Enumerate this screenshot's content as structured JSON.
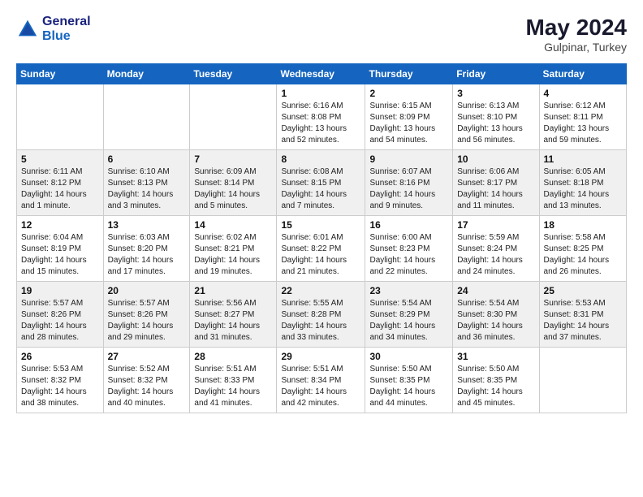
{
  "header": {
    "logo_line1": "General",
    "logo_line2": "Blue",
    "month_year": "May 2024",
    "location": "Gulpinar, Turkey"
  },
  "weekdays": [
    "Sunday",
    "Monday",
    "Tuesday",
    "Wednesday",
    "Thursday",
    "Friday",
    "Saturday"
  ],
  "weeks": [
    [
      {
        "day": "",
        "sunrise": "",
        "sunset": "",
        "daylight": ""
      },
      {
        "day": "",
        "sunrise": "",
        "sunset": "",
        "daylight": ""
      },
      {
        "day": "",
        "sunrise": "",
        "sunset": "",
        "daylight": ""
      },
      {
        "day": "1",
        "sunrise": "Sunrise: 6:16 AM",
        "sunset": "Sunset: 8:08 PM",
        "daylight": "Daylight: 13 hours and 52 minutes."
      },
      {
        "day": "2",
        "sunrise": "Sunrise: 6:15 AM",
        "sunset": "Sunset: 8:09 PM",
        "daylight": "Daylight: 13 hours and 54 minutes."
      },
      {
        "day": "3",
        "sunrise": "Sunrise: 6:13 AM",
        "sunset": "Sunset: 8:10 PM",
        "daylight": "Daylight: 13 hours and 56 minutes."
      },
      {
        "day": "4",
        "sunrise": "Sunrise: 6:12 AM",
        "sunset": "Sunset: 8:11 PM",
        "daylight": "Daylight: 13 hours and 59 minutes."
      }
    ],
    [
      {
        "day": "5",
        "sunrise": "Sunrise: 6:11 AM",
        "sunset": "Sunset: 8:12 PM",
        "daylight": "Daylight: 14 hours and 1 minute."
      },
      {
        "day": "6",
        "sunrise": "Sunrise: 6:10 AM",
        "sunset": "Sunset: 8:13 PM",
        "daylight": "Daylight: 14 hours and 3 minutes."
      },
      {
        "day": "7",
        "sunrise": "Sunrise: 6:09 AM",
        "sunset": "Sunset: 8:14 PM",
        "daylight": "Daylight: 14 hours and 5 minutes."
      },
      {
        "day": "8",
        "sunrise": "Sunrise: 6:08 AM",
        "sunset": "Sunset: 8:15 PM",
        "daylight": "Daylight: 14 hours and 7 minutes."
      },
      {
        "day": "9",
        "sunrise": "Sunrise: 6:07 AM",
        "sunset": "Sunset: 8:16 PM",
        "daylight": "Daylight: 14 hours and 9 minutes."
      },
      {
        "day": "10",
        "sunrise": "Sunrise: 6:06 AM",
        "sunset": "Sunset: 8:17 PM",
        "daylight": "Daylight: 14 hours and 11 minutes."
      },
      {
        "day": "11",
        "sunrise": "Sunrise: 6:05 AM",
        "sunset": "Sunset: 8:18 PM",
        "daylight": "Daylight: 14 hours and 13 minutes."
      }
    ],
    [
      {
        "day": "12",
        "sunrise": "Sunrise: 6:04 AM",
        "sunset": "Sunset: 8:19 PM",
        "daylight": "Daylight: 14 hours and 15 minutes."
      },
      {
        "day": "13",
        "sunrise": "Sunrise: 6:03 AM",
        "sunset": "Sunset: 8:20 PM",
        "daylight": "Daylight: 14 hours and 17 minutes."
      },
      {
        "day": "14",
        "sunrise": "Sunrise: 6:02 AM",
        "sunset": "Sunset: 8:21 PM",
        "daylight": "Daylight: 14 hours and 19 minutes."
      },
      {
        "day": "15",
        "sunrise": "Sunrise: 6:01 AM",
        "sunset": "Sunset: 8:22 PM",
        "daylight": "Daylight: 14 hours and 21 minutes."
      },
      {
        "day": "16",
        "sunrise": "Sunrise: 6:00 AM",
        "sunset": "Sunset: 8:23 PM",
        "daylight": "Daylight: 14 hours and 22 minutes."
      },
      {
        "day": "17",
        "sunrise": "Sunrise: 5:59 AM",
        "sunset": "Sunset: 8:24 PM",
        "daylight": "Daylight: 14 hours and 24 minutes."
      },
      {
        "day": "18",
        "sunrise": "Sunrise: 5:58 AM",
        "sunset": "Sunset: 8:25 PM",
        "daylight": "Daylight: 14 hours and 26 minutes."
      }
    ],
    [
      {
        "day": "19",
        "sunrise": "Sunrise: 5:57 AM",
        "sunset": "Sunset: 8:26 PM",
        "daylight": "Daylight: 14 hours and 28 minutes."
      },
      {
        "day": "20",
        "sunrise": "Sunrise: 5:57 AM",
        "sunset": "Sunset: 8:26 PM",
        "daylight": "Daylight: 14 hours and 29 minutes."
      },
      {
        "day": "21",
        "sunrise": "Sunrise: 5:56 AM",
        "sunset": "Sunset: 8:27 PM",
        "daylight": "Daylight: 14 hours and 31 minutes."
      },
      {
        "day": "22",
        "sunrise": "Sunrise: 5:55 AM",
        "sunset": "Sunset: 8:28 PM",
        "daylight": "Daylight: 14 hours and 33 minutes."
      },
      {
        "day": "23",
        "sunrise": "Sunrise: 5:54 AM",
        "sunset": "Sunset: 8:29 PM",
        "daylight": "Daylight: 14 hours and 34 minutes."
      },
      {
        "day": "24",
        "sunrise": "Sunrise: 5:54 AM",
        "sunset": "Sunset: 8:30 PM",
        "daylight": "Daylight: 14 hours and 36 minutes."
      },
      {
        "day": "25",
        "sunrise": "Sunrise: 5:53 AM",
        "sunset": "Sunset: 8:31 PM",
        "daylight": "Daylight: 14 hours and 37 minutes."
      }
    ],
    [
      {
        "day": "26",
        "sunrise": "Sunrise: 5:53 AM",
        "sunset": "Sunset: 8:32 PM",
        "daylight": "Daylight: 14 hours and 38 minutes."
      },
      {
        "day": "27",
        "sunrise": "Sunrise: 5:52 AM",
        "sunset": "Sunset: 8:32 PM",
        "daylight": "Daylight: 14 hours and 40 minutes."
      },
      {
        "day": "28",
        "sunrise": "Sunrise: 5:51 AM",
        "sunset": "Sunset: 8:33 PM",
        "daylight": "Daylight: 14 hours and 41 minutes."
      },
      {
        "day": "29",
        "sunrise": "Sunrise: 5:51 AM",
        "sunset": "Sunset: 8:34 PM",
        "daylight": "Daylight: 14 hours and 42 minutes."
      },
      {
        "day": "30",
        "sunrise": "Sunrise: 5:50 AM",
        "sunset": "Sunset: 8:35 PM",
        "daylight": "Daylight: 14 hours and 44 minutes."
      },
      {
        "day": "31",
        "sunrise": "Sunrise: 5:50 AM",
        "sunset": "Sunset: 8:35 PM",
        "daylight": "Daylight: 14 hours and 45 minutes."
      },
      {
        "day": "",
        "sunrise": "",
        "sunset": "",
        "daylight": ""
      }
    ]
  ]
}
